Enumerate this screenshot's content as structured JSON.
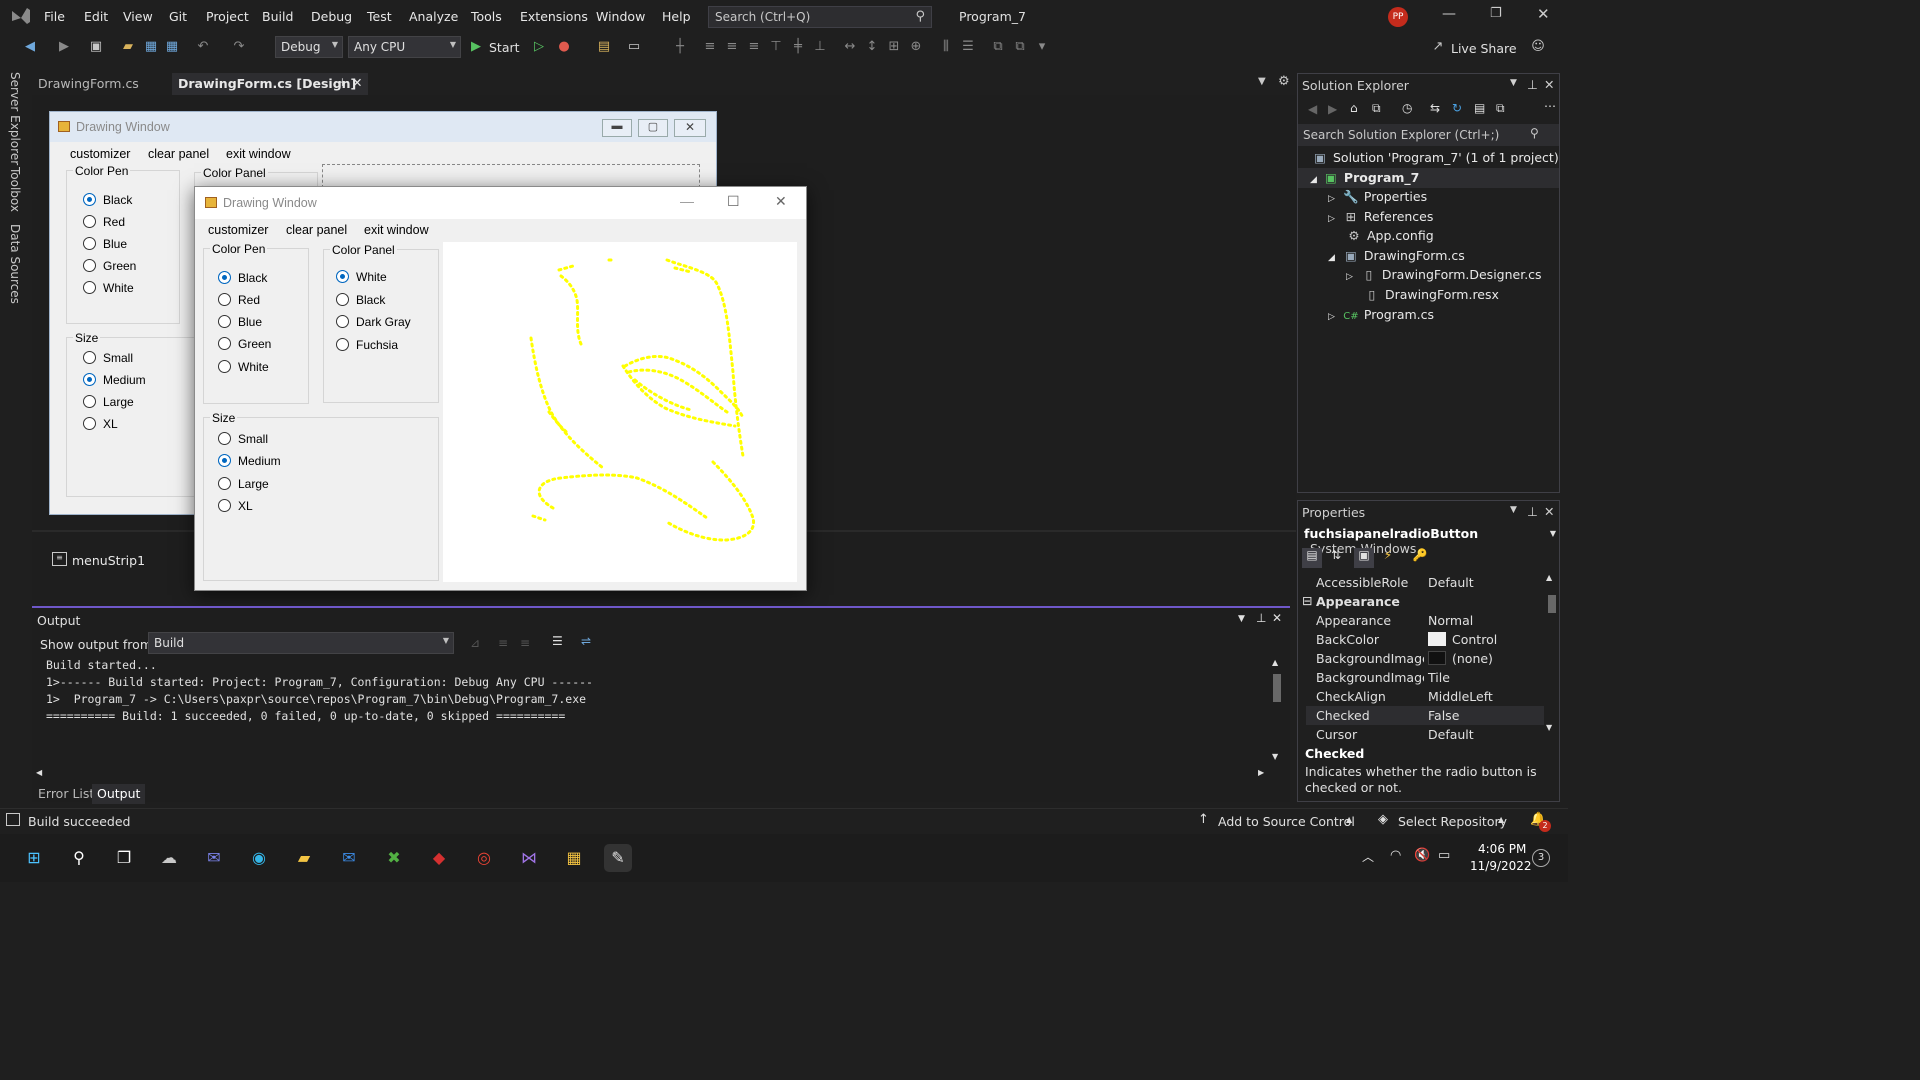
{
  "app": {
    "menu": [
      "File",
      "Edit",
      "View",
      "Git",
      "Project",
      "Build",
      "Debug",
      "Test",
      "Analyze",
      "Tools",
      "Extensions",
      "Window",
      "Help"
    ],
    "search_placeholder": "Search (Ctrl+Q)",
    "solution_title": "Program_7",
    "user_initials": "PP",
    "live_share": "Live Share"
  },
  "toolbar": {
    "config": "Debug",
    "platform": "Any CPU",
    "start_label": "Start"
  },
  "left_tabs": [
    "Server Explorer",
    "Toolbox",
    "Data Sources"
  ],
  "doc_tabs": [
    {
      "label": "DrawingForm.cs",
      "active": false
    },
    {
      "label": "DrawingForm.cs [Design]",
      "active": true
    }
  ],
  "design_form": {
    "title": "Drawing Window",
    "menu": [
      "customizer",
      "clear panel",
      "exit window"
    ],
    "color_pen_title": "Color Pen",
    "color_pen": [
      "Black",
      "Red",
      "Blue",
      "Green",
      "White"
    ],
    "color_panel_title": "Color Panel",
    "size_title": "Size",
    "sizes": [
      "Small",
      "Medium",
      "Large",
      "XL"
    ]
  },
  "run_form": {
    "title": "Drawing Window",
    "menu": [
      "customizer",
      "clear panel",
      "exit window"
    ],
    "color_pen_title": "Color Pen",
    "color_pen": [
      "Black",
      "Red",
      "Blue",
      "Green",
      "White"
    ],
    "color_panel_title": "Color Panel",
    "color_panel": [
      "White",
      "Black",
      "Dark Gray",
      "Fuchsia"
    ],
    "size_title": "Size",
    "sizes": [
      "Small",
      "Medium",
      "Large",
      "XL"
    ],
    "stroke_color": "#ffff00"
  },
  "tray": {
    "component": "menuStrip1"
  },
  "solution_explorer": {
    "title": "Solution Explorer",
    "search_placeholder": "Search Solution Explorer (Ctrl+;)",
    "items": [
      {
        "label": "Solution 'Program_7' (1 of 1 project)",
        "icon": "solution-icon"
      },
      {
        "label": "Program_7",
        "icon": "csharp-project-icon"
      },
      {
        "label": "Properties",
        "icon": "wrench-icon"
      },
      {
        "label": "References",
        "icon": "references-icon"
      },
      {
        "label": "App.config",
        "icon": "config-icon"
      },
      {
        "label": "DrawingForm.cs",
        "icon": "form-icon"
      },
      {
        "label": "DrawingForm.Designer.cs",
        "icon": "file-icon"
      },
      {
        "label": "DrawingForm.resx",
        "icon": "file-icon"
      },
      {
        "label": "Program.cs",
        "icon": "csharp-file-icon"
      }
    ]
  },
  "properties": {
    "title": "Properties",
    "object": "fuchsiapanelradioButton",
    "object_type": "System.Windows",
    "rows": [
      {
        "k": "AccessibleRole",
        "v": "Default"
      },
      {
        "k": "Appearance",
        "v": "",
        "category": true
      },
      {
        "k": "Appearance",
        "v": "Normal"
      },
      {
        "k": "BackColor",
        "v": "Control"
      },
      {
        "k": "BackgroundImage",
        "v": "(none)"
      },
      {
        "k": "BackgroundImageLa",
        "v": "Tile"
      },
      {
        "k": "CheckAlign",
        "v": "MiddleLeft"
      },
      {
        "k": "Checked",
        "v": "False"
      },
      {
        "k": "Cursor",
        "v": "Default"
      }
    ],
    "desc_title": "Checked",
    "desc_text": "Indicates whether the radio button is checked or not."
  },
  "output": {
    "title": "Output",
    "show_from_label": "Show output from:",
    "source": "Build",
    "lines": [
      "Build started...",
      "1>------ Build started: Project: Program_7, Configuration: Debug Any CPU ------",
      "1>  Program_7 -> C:\\Users\\paxpr\\source\\repos\\Program_7\\bin\\Debug\\Program_7.exe",
      "========== Build: 1 succeeded, 0 failed, 0 up-to-date, 0 skipped =========="
    ],
    "tabs": [
      "Error List",
      "Output"
    ]
  },
  "status": {
    "text": "Build succeeded",
    "source_control": "Add to Source Control",
    "repo": "Select Repository",
    "notifications": "2"
  },
  "taskbar": {
    "time": "4:06 PM",
    "date": "11/9/2022",
    "badge": "3"
  }
}
